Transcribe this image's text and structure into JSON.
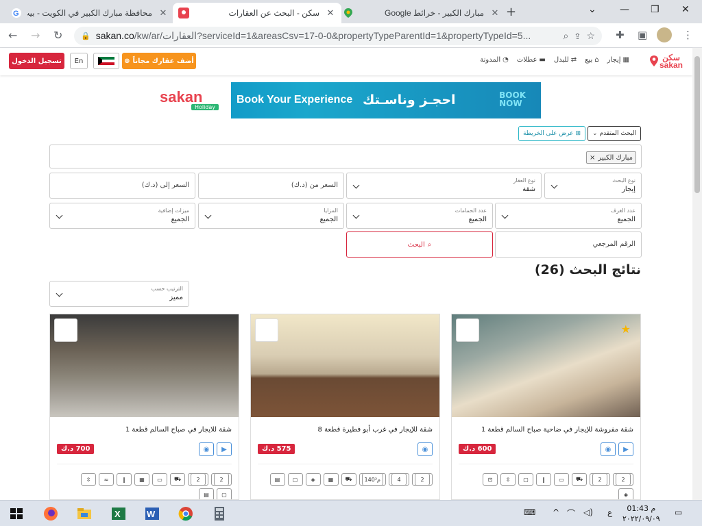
{
  "browser": {
    "tabs": [
      {
        "title": "محافظة مبارك الكبير في الكويت - بيت",
        "close": "✕"
      },
      {
        "title": "سكن - البحث عن العقارات",
        "close": "✕"
      },
      {
        "title": "مبارك الكبير - خرائط Google",
        "close": "✕"
      }
    ],
    "new_tab": "+",
    "url_host": "sakan.co",
    "url_path": "/kw/ar/العقارات?serviceId=1&areasCsv=17-0-0&propertyTypeParentId=1&propertyTypeId=5...",
    "controls": {
      "minimize": "—",
      "restore": "❐",
      "close": "✕",
      "chevron": "⌄"
    }
  },
  "site": {
    "logo_ar": "سكن",
    "logo_en": "sakan",
    "nav": [
      "إيجار",
      "بيع",
      "للبدل",
      "عطلات",
      "المدونة"
    ],
    "add_property": "أضف عقارك مجاناً",
    "lang": "En",
    "login": "تسجيل الدخول"
  },
  "banner": {
    "brand": "sakan",
    "sub": "Holiday",
    "text_en": "Book Your Experience",
    "text_ar": "احجـز وناسـتك",
    "cta1": "BOOK",
    "cta2": "NOW"
  },
  "search": {
    "advanced": "البحث المتقدم",
    "map_view": "عرض على الخريطة",
    "chip": "مبارك الكبير",
    "chip_x": "×",
    "fields": {
      "search_type": {
        "label": "نوع البحث",
        "value": "إيجار"
      },
      "property_type": {
        "label": "نوع العقار",
        "value": "شقة"
      },
      "price_from": {
        "placeholder": "السعر من (د.ك)"
      },
      "price_to": {
        "placeholder": "السعر إلى (د.ك)"
      },
      "rooms": {
        "label": "عدد الغرف",
        "value": "الجميع"
      },
      "baths": {
        "label": "عدد الحمامات",
        "value": "الجميع"
      },
      "amenities": {
        "label": "المزايا",
        "value": "الجميع"
      },
      "extras": {
        "label": "ميزات إضافية",
        "value": "الجميع"
      },
      "ref": {
        "placeholder": "الرقم المرجعي"
      }
    },
    "search_btn": "البحث"
  },
  "results": {
    "title": "نتائج البحث (26)",
    "sort_label": "الترتيب حسب",
    "sort_value": "مميز",
    "cards": [
      {
        "title": "شقة مفروشة للإيجار في ضاحية صباح السالم قطعة 1",
        "price": "600 د.ك",
        "feats": [
          "2",
          "2",
          "",
          "",
          "",
          "",
          "",
          "",
          "",
          ""
        ]
      },
      {
        "title": "شقة للإيجار في غرب أبو فطيرة قطعة 8",
        "price": "575 د.ك",
        "feats": [
          "2",
          "4",
          "140م²",
          "",
          "",
          "",
          "",
          ""
        ]
      },
      {
        "title": "شقة للايجار في صباح السالم قطعة 1",
        "price": "700 د.ك",
        "feats": [
          "2",
          "2",
          "",
          "",
          "",
          "",
          "",
          "",
          "",
          ""
        ]
      }
    ]
  },
  "taskbar": {
    "time": "01:43 م",
    "date": "٢٠٢٢/٠٩/٠٩",
    "lang": "ع"
  }
}
